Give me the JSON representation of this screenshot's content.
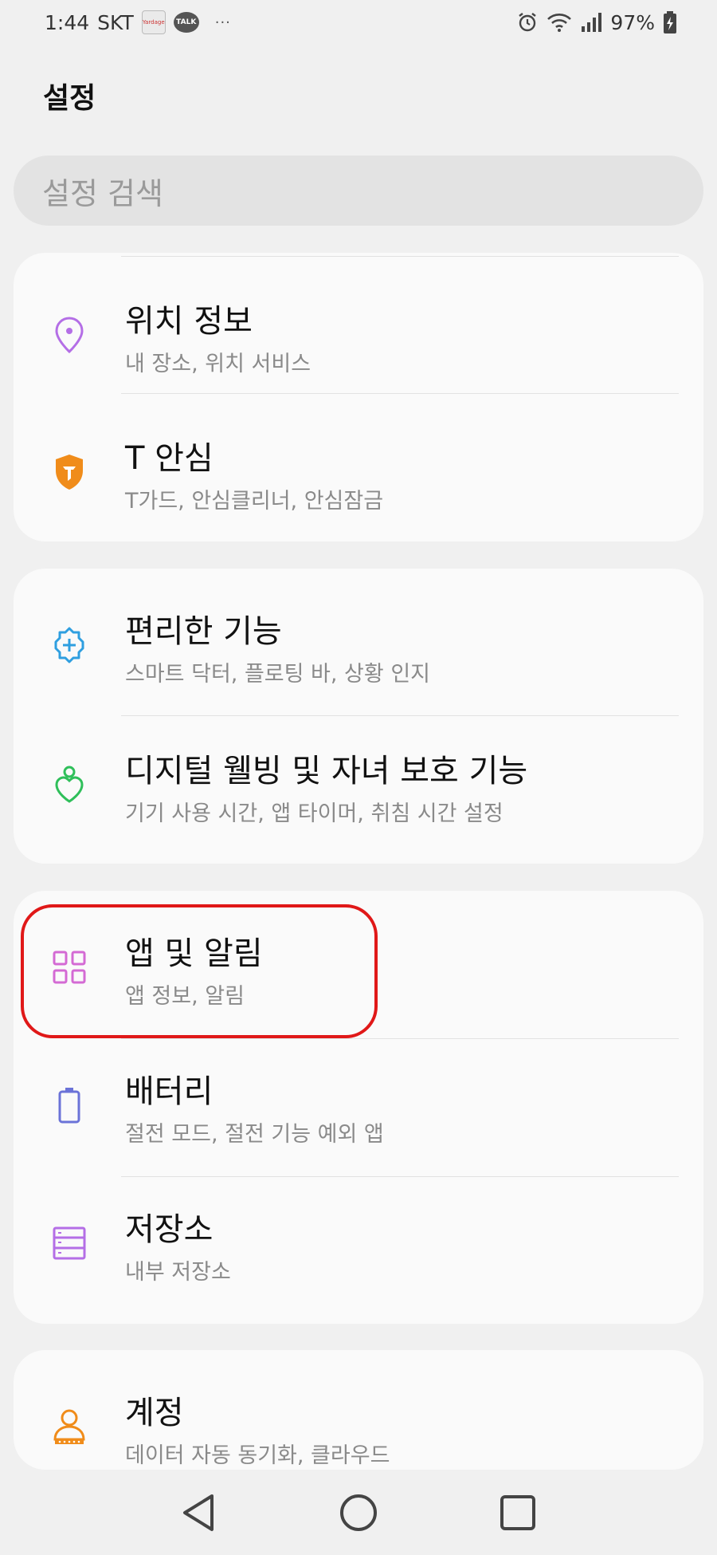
{
  "status_bar": {
    "time": "1:44",
    "carrier": "SKT",
    "notif_app_1": "yardage-app-icon",
    "notif_app_1_text": "Yardage",
    "notif_app_2": "kakaotalk-icon",
    "notif_app_2_text": "TALK",
    "more": "···",
    "battery": "97%"
  },
  "page": {
    "title": "설정"
  },
  "search": {
    "placeholder": "설정 검색"
  },
  "cards": [
    {
      "items": [
        {
          "icon": "location-pin-icon",
          "icon_color": "#b46ee6",
          "title": "위치 정보",
          "subtitle": "내 장소, 위치 서비스"
        },
        {
          "icon": "t-safety-shield-icon",
          "icon_color": "#f08c1a",
          "title": "T 안심",
          "subtitle": "T가드, 안심클리너, 안심잠금"
        }
      ]
    },
    {
      "items": [
        {
          "icon": "gear-plus-icon",
          "icon_color": "#2f9fe0",
          "title": "편리한 기능",
          "subtitle": "스마트 닥터, 플로팅 바, 상황 인지"
        },
        {
          "icon": "wellbeing-heart-icon",
          "icon_color": "#2fbf5a",
          "title": "디지털 웰빙 및 자녀 보호 기능",
          "subtitle": "기기 사용 시간, 앱 타이머, 취침 시간 설정"
        }
      ]
    },
    {
      "items": [
        {
          "icon": "apps-grid-icon",
          "icon_color": "#d46ad4",
          "title": "앱 및 알림",
          "subtitle": "앱 정보, 알림"
        },
        {
          "icon": "battery-icon",
          "icon_color": "#6b73d8",
          "title": "배터리",
          "subtitle": "절전 모드, 절전 기능 예외 앱"
        },
        {
          "icon": "storage-icon",
          "icon_color": "#b46ee6",
          "title": "저장소",
          "subtitle": "내부 저장소"
        }
      ]
    },
    {
      "items": [
        {
          "icon": "account-person-icon",
          "icon_color": "#f08c1a",
          "title": "계정",
          "subtitle": "데이터 자동 동기화, 클라우드"
        }
      ]
    }
  ],
  "highlight": {
    "color": "#e01818"
  },
  "nav": {
    "back": "back-triangle-icon",
    "home": "home-circle-icon",
    "recents": "recents-square-icon"
  }
}
